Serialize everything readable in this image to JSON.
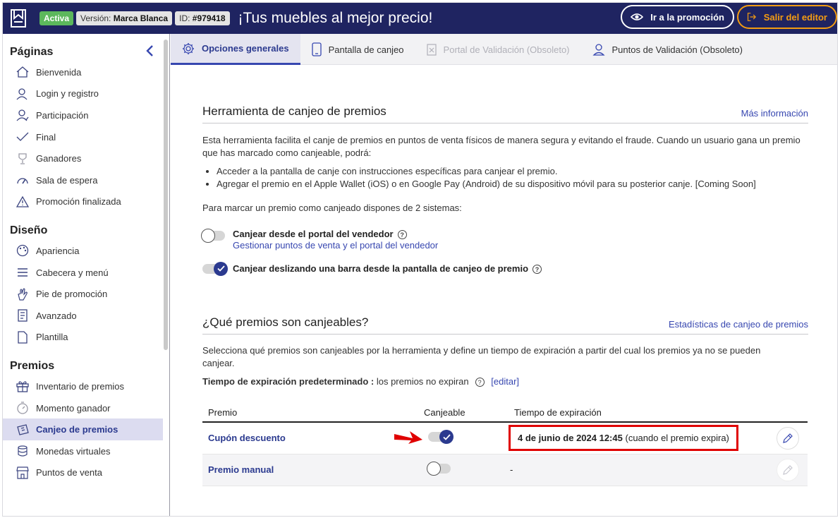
{
  "header": {
    "status_badge": "Activa",
    "version_label": "Versión:",
    "version_value": "Marca Blanca",
    "id_label": "ID:",
    "id_value": "#979418",
    "title": "¡Tus muebles al mejor precio!",
    "promo_button": "Ir a la promoción",
    "exit_button": "Salir del editor"
  },
  "sidebar": {
    "sections": [
      {
        "title": "Páginas",
        "items": [
          {
            "label": "Bienvenida",
            "icon": "home-icon"
          },
          {
            "label": "Login y registro",
            "icon": "user-login-icon"
          },
          {
            "label": "Participación",
            "icon": "user-participation-icon"
          },
          {
            "label": "Final",
            "icon": "check-icon"
          },
          {
            "label": "Ganadores",
            "icon": "trophy-icon"
          },
          {
            "label": "Sala de espera",
            "icon": "gauge-icon"
          },
          {
            "label": "Promoción finalizada",
            "icon": "warning-icon"
          }
        ]
      },
      {
        "title": "Diseño",
        "items": [
          {
            "label": "Apariencia",
            "icon": "palette-icon"
          },
          {
            "label": "Cabecera y menú",
            "icon": "menu-icon"
          },
          {
            "label": "Pie de promoción",
            "icon": "hand-icon"
          },
          {
            "label": "Avanzado",
            "icon": "code-icon"
          },
          {
            "label": "Plantilla",
            "icon": "document-icon"
          }
        ]
      },
      {
        "title": "Premios",
        "items": [
          {
            "label": "Inventario de premios",
            "icon": "gift-icon"
          },
          {
            "label": "Momento ganador",
            "icon": "clock-icon"
          },
          {
            "label": "Canjeo de premios",
            "icon": "ticket-icon",
            "active": true
          },
          {
            "label": "Monedas virtuales",
            "icon": "coins-icon"
          },
          {
            "label": "Puntos de venta",
            "icon": "store-icon"
          }
        ]
      }
    ]
  },
  "tabs": [
    {
      "label": "Opciones generales",
      "icon": "gear-icon",
      "state": "active"
    },
    {
      "label": "Pantalla de canjeo",
      "icon": "phone-icon",
      "state": "normal"
    },
    {
      "label": "Portal de Validación (Obsoleto)",
      "icon": "clipboard-icon",
      "state": "disabled"
    },
    {
      "label": "Puntos de Validación (Obsoleto)",
      "icon": "location-user-icon",
      "state": "normal"
    }
  ],
  "tool_section": {
    "title": "Herramienta de canjeo de premios",
    "more_info": "Más información",
    "intro": "Esta herramienta facilita el canje de premios en puntos de venta físicos de manera segura y evitando el fraude. Cuando un usuario gana un premio que has marcado como canjeable, podrá:",
    "bullets": [
      "Acceder a la pantalla de canje con instrucciones específicas para canjear el premio.",
      "Agregar el premio en el Apple Wallet (iOS) o en Google Pay (Android) de su dispositivo móvil para su posterior canje. [Coming Soon]"
    ],
    "systems_text": "Para marcar un premio como canjeado dispones de 2 sistemas:",
    "option1_label": "Canjear desde el portal del vendedor",
    "option1_link": "Gestionar puntos de venta y el portal del vendedor",
    "option1_enabled": false,
    "option2_label": "Canjear deslizando una barra desde la pantalla de canjeo de premio",
    "option2_enabled": true
  },
  "prizes_section": {
    "title": "¿Qué premios son canjeables?",
    "stats_link": "Estadísticas de canjeo de premios",
    "description": "Selecciona qué premios son canjeables por la herramienta y define un tiempo de expiración a partir del cual los premios ya no se pueden canjear.",
    "default_expiry_label": "Tiempo de expiración predeterminado :",
    "default_expiry_value": "los premios no expiran",
    "edit_link": "[editar]",
    "columns": [
      "Premio",
      "Canjeable",
      "Tiempo de expiración"
    ],
    "rows": [
      {
        "name": "Cupón descuento",
        "redeemable": true,
        "expiry_date": "4 de junio de 2024 12:45",
        "expiry_note": "(cuando el premio expira)"
      },
      {
        "name": "Premio manual",
        "redeemable": false,
        "expiry_date": "-",
        "expiry_note": ""
      }
    ]
  },
  "colors": {
    "header_bg": "#1f2461",
    "accent": "#3747b0",
    "active_badge": "#5cb85c",
    "exit_orange": "#f39c12",
    "highlight_red": "#e00000"
  }
}
